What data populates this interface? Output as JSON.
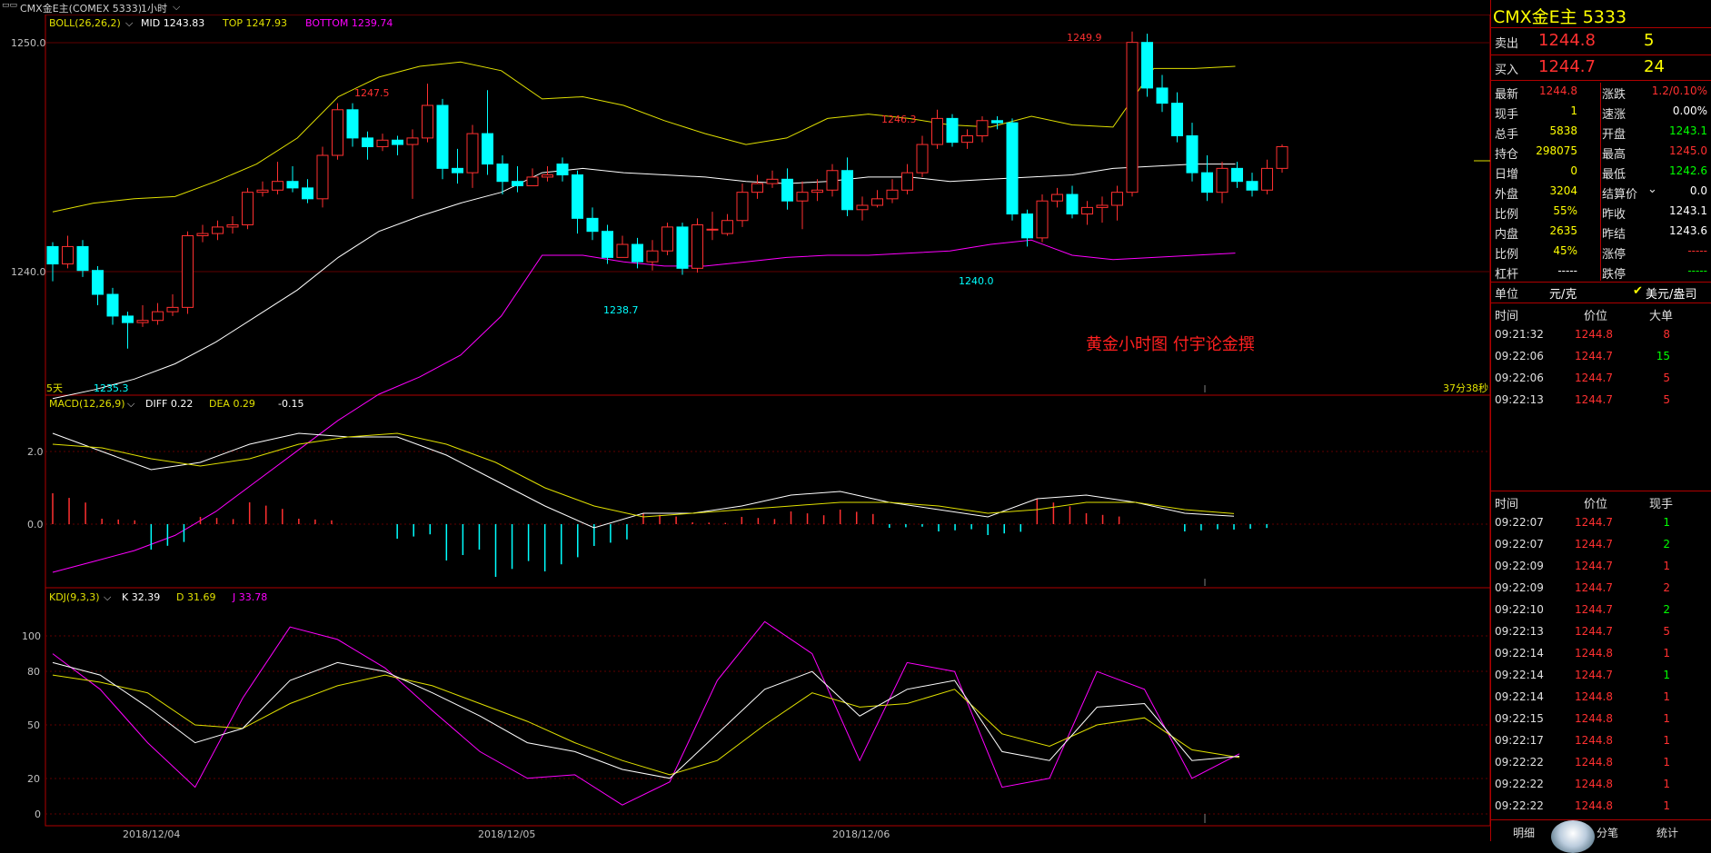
{
  "app": {
    "instrument_tab": "CMX金E主(COMEX 5333)",
    "period": "1小时",
    "chevron": "chevron-down-icon",
    "watermark": "黄金小时图  付宇论金撰",
    "days_label": "5天",
    "countdown": "37分38秒",
    "colors": {
      "up": "#ff3030",
      "down": "#00ffff",
      "mid": "#ffffff",
      "top": "#e0e000",
      "bottom": "#ff00ff",
      "grid": "#b00000"
    }
  },
  "boll": {
    "title": "BOLL(26,26,2)",
    "mid": "MID 1243.83",
    "top": "TOP 1247.93",
    "bottom": "BOTTOM 1239.74"
  },
  "macd": {
    "title": "MACD(12,26,9)",
    "diff": "DIFF 0.22",
    "dea": "DEA 0.29",
    "macd": "-0.15"
  },
  "kdj": {
    "title": "KDJ(9,3,3)",
    "k": "K 32.39",
    "d": "D 31.69",
    "j": "J 33.78"
  },
  "axes": {
    "price_ticks": [
      "1250.0",
      "1240.0"
    ],
    "macd_ticks": [
      "2.0",
      "0.0"
    ],
    "kdj_ticks": [
      "100",
      "80",
      "50",
      "20",
      "0"
    ],
    "dates": [
      "2018/12/04",
      "2018/12/05",
      "2018/12/06"
    ]
  },
  "annotations": {
    "hi1": "1247.5",
    "hi2": "1246.3",
    "hi3": "1249.9",
    "lo1": "1235.3",
    "lo2": "1238.7",
    "lo3": "1240.0"
  },
  "chart_data": {
    "type": "candlestick",
    "ylim": [
      1233.2,
      1250.6
    ],
    "candles": [
      [
        1240.0,
        1239.2,
        1240.2,
        1238.4
      ],
      [
        1239.2,
        1240.0,
        1240.5,
        1239.0
      ],
      [
        1240.0,
        1238.9,
        1240.3,
        1238.6
      ],
      [
        1238.9,
        1237.8,
        1239.1,
        1237.3
      ],
      [
        1237.8,
        1236.8,
        1238.1,
        1236.4
      ],
      [
        1236.8,
        1236.5,
        1237.0,
        1235.3
      ],
      [
        1236.5,
        1236.6,
        1237.3,
        1236.3
      ],
      [
        1236.6,
        1237.0,
        1237.4,
        1236.4
      ],
      [
        1237.0,
        1237.2,
        1237.8,
        1236.8
      ],
      [
        1237.2,
        1240.5,
        1240.7,
        1236.9
      ],
      [
        1240.5,
        1240.6,
        1241.0,
        1240.2
      ],
      [
        1240.6,
        1240.9,
        1241.2,
        1240.3
      ],
      [
        1240.9,
        1241.0,
        1241.4,
        1240.6
      ],
      [
        1241.0,
        1242.5,
        1242.7,
        1240.8
      ],
      [
        1242.5,
        1242.6,
        1243.0,
        1242.3
      ],
      [
        1242.6,
        1243.0,
        1243.9,
        1242.4
      ],
      [
        1243.0,
        1242.7,
        1243.7,
        1242.5
      ],
      [
        1242.7,
        1242.2,
        1243.1,
        1242.0
      ],
      [
        1242.2,
        1244.2,
        1244.6,
        1241.8
      ],
      [
        1244.2,
        1246.3,
        1246.6,
        1244.0
      ],
      [
        1246.3,
        1245.0,
        1246.6,
        1244.6
      ],
      [
        1245.0,
        1244.6,
        1245.3,
        1244.0
      ],
      [
        1244.6,
        1244.9,
        1245.2,
        1244.4
      ],
      [
        1244.9,
        1244.7,
        1245.1,
        1244.2
      ],
      [
        1244.7,
        1245.0,
        1245.4,
        1242.2
      ],
      [
        1245.0,
        1246.5,
        1247.5,
        1244.8
      ],
      [
        1246.5,
        1243.6,
        1246.8,
        1243.1
      ],
      [
        1243.6,
        1243.4,
        1244.5,
        1242.9
      ],
      [
        1243.4,
        1245.2,
        1245.6,
        1242.7
      ],
      [
        1245.2,
        1243.8,
        1247.2,
        1243.3
      ],
      [
        1243.8,
        1243.0,
        1244.2,
        1242.4
      ],
      [
        1243.0,
        1242.8,
        1243.7,
        1242.5
      ],
      [
        1242.8,
        1243.2,
        1243.6,
        1242.9
      ],
      [
        1243.2,
        1243.3,
        1243.7,
        1243.0
      ],
      [
        1243.8,
        1243.3,
        1244.1,
        1243.0
      ],
      [
        1243.3,
        1241.3,
        1243.5,
        1240.6
      ],
      [
        1241.3,
        1240.7,
        1241.8,
        1240.3
      ],
      [
        1240.7,
        1239.5,
        1241.0,
        1239.2
      ],
      [
        1239.5,
        1240.1,
        1240.5,
        1239.8
      ],
      [
        1240.1,
        1239.3,
        1240.4,
        1239.0
      ],
      [
        1239.3,
        1239.8,
        1240.3,
        1238.9
      ],
      [
        1239.8,
        1240.9,
        1241.1,
        1239.6
      ],
      [
        1240.9,
        1239.0,
        1241.1,
        1238.7
      ],
      [
        1239.0,
        1241.0,
        1241.3,
        1238.8
      ],
      [
        1240.8,
        1240.8,
        1241.6,
        1240.3
      ],
      [
        1240.6,
        1241.2,
        1241.5,
        1240.5
      ],
      [
        1241.2,
        1242.5,
        1242.9,
        1240.9
      ],
      [
        1242.5,
        1242.9,
        1243.3,
        1242.2
      ],
      [
        1242.9,
        1243.1,
        1243.5,
        1242.7
      ],
      [
        1243.1,
        1242.1,
        1243.6,
        1241.7
      ],
      [
        1242.1,
        1242.5,
        1243.0,
        1240.8
      ],
      [
        1242.5,
        1242.6,
        1243.1,
        1242.1
      ],
      [
        1242.6,
        1243.5,
        1243.8,
        1242.3
      ],
      [
        1243.5,
        1241.7,
        1244.1,
        1241.4
      ],
      [
        1241.7,
        1241.9,
        1242.3,
        1241.2
      ],
      [
        1241.9,
        1242.2,
        1242.6,
        1241.8
      ],
      [
        1242.2,
        1242.6,
        1243.1,
        1242.0
      ],
      [
        1242.6,
        1243.4,
        1243.8,
        1242.4
      ],
      [
        1243.4,
        1244.7,
        1245.1,
        1243.2
      ],
      [
        1244.7,
        1245.9,
        1246.3,
        1244.5
      ],
      [
        1245.9,
        1244.8,
        1246.1,
        1244.6
      ],
      [
        1244.8,
        1245.1,
        1245.4,
        1244.5
      ],
      [
        1245.1,
        1245.8,
        1246.0,
        1244.8
      ],
      [
        1245.8,
        1245.7,
        1246.0,
        1245.4
      ],
      [
        1245.7,
        1241.5,
        1245.9,
        1241.2
      ],
      [
        1241.5,
        1240.4,
        1241.7,
        1240.0
      ],
      [
        1240.4,
        1242.1,
        1242.4,
        1240.2
      ],
      [
        1242.1,
        1242.4,
        1242.7,
        1241.8
      ],
      [
        1242.4,
        1241.5,
        1242.8,
        1241.3
      ],
      [
        1241.5,
        1241.8,
        1242.1,
        1241.0
      ],
      [
        1241.8,
        1241.9,
        1242.3,
        1241.1
      ],
      [
        1241.9,
        1242.5,
        1242.8,
        1241.2
      ],
      [
        1242.5,
        1249.4,
        1249.9,
        1242.3
      ],
      [
        1249.4,
        1247.3,
        1249.8,
        1246.9
      ],
      [
        1247.3,
        1246.6,
        1247.9,
        1246.2
      ],
      [
        1246.6,
        1245.1,
        1247.1,
        1244.8
      ],
      [
        1245.1,
        1243.4,
        1245.7,
        1243.0
      ],
      [
        1243.4,
        1242.5,
        1244.2,
        1242.1
      ],
      [
        1242.5,
        1243.6,
        1243.9,
        1242.0
      ],
      [
        1243.6,
        1243.0,
        1243.9,
        1242.7
      ],
      [
        1243.0,
        1242.6,
        1243.4,
        1242.3
      ],
      [
        1242.6,
        1243.6,
        1244.0,
        1242.4
      ],
      [
        1243.6,
        1244.6,
        1244.7,
        1243.4
      ]
    ],
    "sample_step": 26,
    "boll_top": [
      1241.6,
      1242.0,
      1242.2,
      1242.3,
      1243.0,
      1243.8,
      1245.0,
      1246.9,
      1247.8,
      1248.3,
      1248.5,
      1248.1,
      1246.8,
      1246.9,
      1246.5,
      1245.8,
      1245.2,
      1244.7,
      1245.0,
      1245.9,
      1246.1,
      1245.9,
      1245.6,
      1245.5,
      1246.0,
      1245.6,
      1245.5,
      1248.2,
      1248.2,
      1248.3
    ],
    "boll_mid": [
      1233.0,
      1233.4,
      1233.9,
      1234.6,
      1235.6,
      1236.8,
      1238.0,
      1239.5,
      1240.7,
      1241.4,
      1242.0,
      1242.5,
      1243.4,
      1243.6,
      1243.4,
      1243.3,
      1243.2,
      1243.0,
      1242.9,
      1243.0,
      1243.2,
      1243.2,
      1243.0,
      1243.1,
      1243.2,
      1243.3,
      1243.6,
      1243.7,
      1243.8,
      1243.8
    ],
    "boll_bottom": [
      1225.0,
      1225.5,
      1226.0,
      1226.7,
      1227.8,
      1229.2,
      1230.6,
      1232.0,
      1233.2,
      1234.0,
      1235.0,
      1236.8,
      1239.6,
      1239.6,
      1239.3,
      1239.1,
      1239.1,
      1239.3,
      1239.5,
      1239.6,
      1239.6,
      1239.7,
      1239.8,
      1240.1,
      1240.3,
      1239.6,
      1239.4,
      1239.5,
      1239.6,
      1239.7
    ],
    "macd_diff": [
      2.5,
      2.0,
      1.5,
      1.7,
      2.2,
      2.5,
      2.4,
      2.4,
      1.9,
      1.2,
      0.5,
      -0.1,
      0.3,
      0.3,
      0.5,
      0.8,
      0.9,
      0.6,
      0.4,
      0.2,
      0.7,
      0.8,
      0.6,
      0.3,
      0.22
    ],
    "macd_dea": [
      2.2,
      2.1,
      1.8,
      1.6,
      1.8,
      2.2,
      2.4,
      2.5,
      2.2,
      1.7,
      1.0,
      0.5,
      0.2,
      0.3,
      0.4,
      0.5,
      0.6,
      0.6,
      0.5,
      0.3,
      0.4,
      0.6,
      0.6,
      0.4,
      0.29
    ],
    "macd_hist": [
      0.85,
      0.15,
      -0.7,
      0.2,
      0.6,
      0.15,
      0.0,
      -0.4,
      -1.0,
      -1.45,
      -1.3,
      -0.6,
      0.3,
      0.05,
      0.2,
      0.35,
      0.4,
      -0.1,
      -0.2,
      -0.3,
      0.7,
      0.3,
      0.0,
      -0.2,
      -0.15
    ],
    "kdj_k": [
      85,
      78,
      60,
      40,
      48,
      75,
      85,
      80,
      68,
      55,
      40,
      35,
      25,
      20,
      45,
      70,
      80,
      55,
      70,
      75,
      35,
      30,
      60,
      62,
      30,
      32.39
    ],
    "kdj_d": [
      78,
      74,
      68,
      50,
      48,
      62,
      72,
      78,
      72,
      62,
      52,
      40,
      30,
      22,
      30,
      50,
      68,
      60,
      62,
      70,
      45,
      38,
      50,
      54,
      36,
      31.69
    ],
    "kdj_j": [
      90,
      70,
      40,
      15,
      65,
      105,
      98,
      82,
      58,
      35,
      20,
      22,
      5,
      18,
      75,
      108,
      90,
      30,
      85,
      80,
      15,
      20,
      80,
      70,
      20,
      33.78
    ]
  },
  "quote": {
    "title": "CMX金E主  5333",
    "sell_label": "卖出",
    "sell_price": "1244.8",
    "sell_vol": "5",
    "buy_label": "买入",
    "buy_price": "1244.7",
    "buy_vol": "24",
    "stats": [
      {
        "l1": "最新",
        "v1": "1244.8",
        "c1": "red",
        "l2": "涨跌",
        "v2": "1.2/0.10%",
        "c2": "red"
      },
      {
        "l1": "现手",
        "v1": "1",
        "c1": "yel",
        "l2": "速涨",
        "v2": "0.00%",
        "c2": "wht"
      },
      {
        "l1": "总手",
        "v1": "5838",
        "c1": "yel",
        "l2": "开盘",
        "v2": "1243.1",
        "c2": "grn"
      },
      {
        "l1": "持仓",
        "v1": "298075",
        "c1": "yel",
        "l2": "最高",
        "v2": "1245.0",
        "c2": "red"
      },
      {
        "l1": "日增",
        "v1": "0",
        "c1": "yel",
        "l2": "最低",
        "v2": "1242.6",
        "c2": "grn"
      },
      {
        "l1": "外盘",
        "v1": "3204",
        "c1": "yel",
        "l2": "结算价",
        "v2": "0.0",
        "c2": "wht"
      },
      {
        "l1": "比例",
        "v1": "55%",
        "c1": "yel",
        "l2": "昨收",
        "v2": "1243.1",
        "c2": "wht"
      },
      {
        "l1": "内盘",
        "v1": "2635",
        "c1": "yel",
        "l2": "昨结",
        "v2": "1243.6",
        "c2": "wht"
      },
      {
        "l1": "比例",
        "v1": "45%",
        "c1": "yel",
        "l2": "涨停",
        "v2": "-----",
        "c2": "red"
      },
      {
        "l1": "杠杆",
        "v1": "-----",
        "c1": "wht",
        "l2": "跌停",
        "v2": "-----",
        "c2": "grn"
      }
    ],
    "unit_label": "单位",
    "unit_value": "元/克",
    "unit_option": "美元/盎司"
  },
  "bigorders": {
    "headers": [
      "时间",
      "价位",
      "大单"
    ],
    "rows": [
      {
        "time": "09:21:32",
        "price": "1244.8",
        "pc": "red",
        "vol": "8",
        "vc": "red"
      },
      {
        "time": "09:22:06",
        "price": "1244.7",
        "pc": "red",
        "vol": "15",
        "vc": "grn"
      },
      {
        "time": "09:22:06",
        "price": "1244.7",
        "pc": "red",
        "vol": "5",
        "vc": "red"
      },
      {
        "time": "09:22:13",
        "price": "1244.7",
        "pc": "red",
        "vol": "5",
        "vc": "red"
      }
    ]
  },
  "ticks": {
    "headers": [
      "时间",
      "价位",
      "现手"
    ],
    "rows": [
      {
        "time": "09:22:07",
        "price": "1244.7",
        "vol": "1",
        "vc": "grn"
      },
      {
        "time": "09:22:07",
        "price": "1244.7",
        "vol": "2",
        "vc": "grn"
      },
      {
        "time": "09:22:09",
        "price": "1244.7",
        "vol": "1",
        "vc": "red"
      },
      {
        "time": "09:22:09",
        "price": "1244.7",
        "vol": "2",
        "vc": "red"
      },
      {
        "time": "09:22:10",
        "price": "1244.7",
        "vol": "2",
        "vc": "grn"
      },
      {
        "time": "09:22:13",
        "price": "1244.7",
        "vol": "5",
        "vc": "red"
      },
      {
        "time": "09:22:14",
        "price": "1244.8",
        "vol": "1",
        "vc": "red"
      },
      {
        "time": "09:22:14",
        "price": "1244.7",
        "vol": "1",
        "vc": "grn"
      },
      {
        "time": "09:22:14",
        "price": "1244.8",
        "vol": "1",
        "vc": "red"
      },
      {
        "time": "09:22:15",
        "price": "1244.8",
        "vol": "1",
        "vc": "red"
      },
      {
        "time": "09:22:17",
        "price": "1244.8",
        "vol": "1",
        "vc": "red"
      },
      {
        "time": "09:22:22",
        "price": "1244.8",
        "vol": "1",
        "vc": "red"
      },
      {
        "time": "09:22:22",
        "price": "1244.8",
        "vol": "1",
        "vc": "red"
      },
      {
        "time": "09:22:22",
        "price": "1244.8",
        "vol": "1",
        "vc": "red"
      }
    ]
  },
  "tabs": {
    "detail": "明细",
    "notes": "分笔",
    "stats": "统计"
  }
}
